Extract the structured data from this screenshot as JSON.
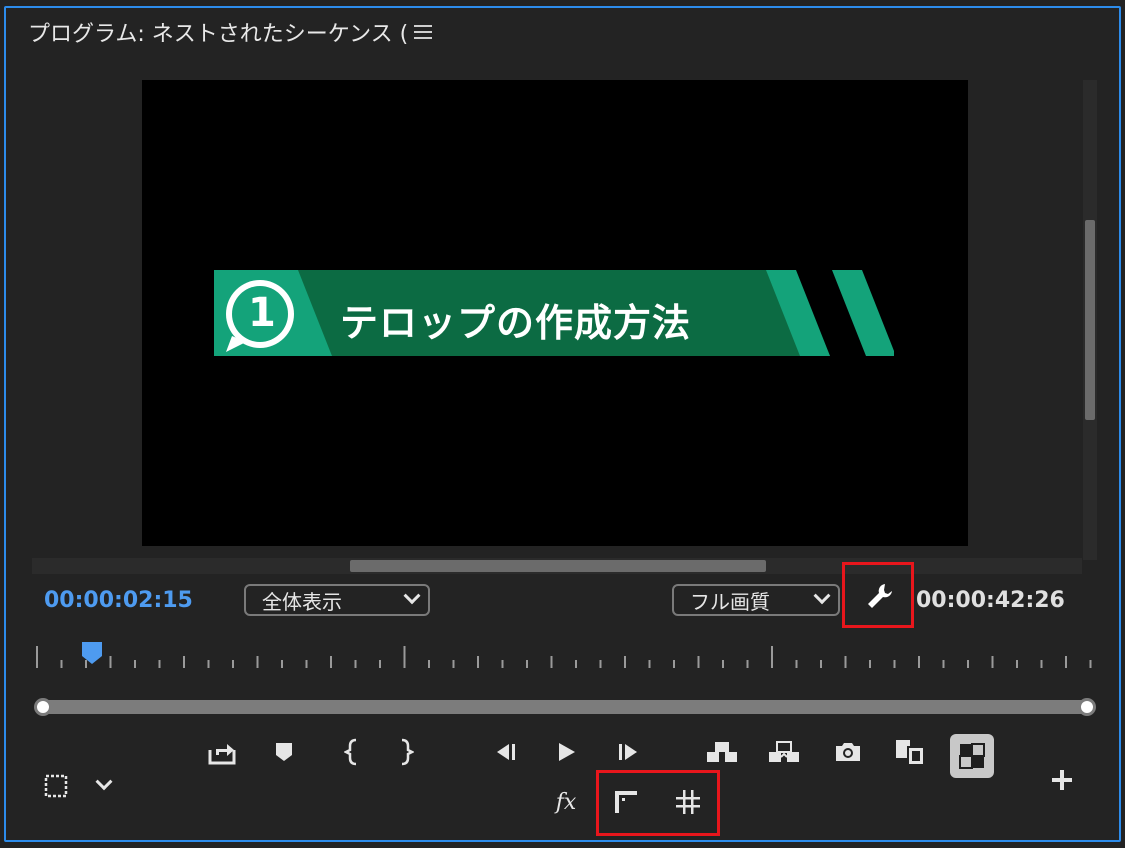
{
  "panel": {
    "title": "プログラム: ネストされたシーケンス (",
    "menu_icon": "hamburger-menu-icon"
  },
  "viewer": {
    "telop": {
      "number": "1",
      "text": "テロップの作成方法"
    }
  },
  "timecode": {
    "current": "00:00:02:15",
    "duration": "00:00:42:26"
  },
  "zoom_dropdown": {
    "selected": "全体表示"
  },
  "quality_dropdown": {
    "selected": "フル画質"
  },
  "toolbar": {
    "fx_label": "fx"
  },
  "colors": {
    "accent": "#2d8ceb",
    "timecode_blue": "#4e9bf0",
    "telop_green_dark": "#0c6b43",
    "telop_green_light": "#14a37a",
    "highlight_red": "#e8161c"
  }
}
